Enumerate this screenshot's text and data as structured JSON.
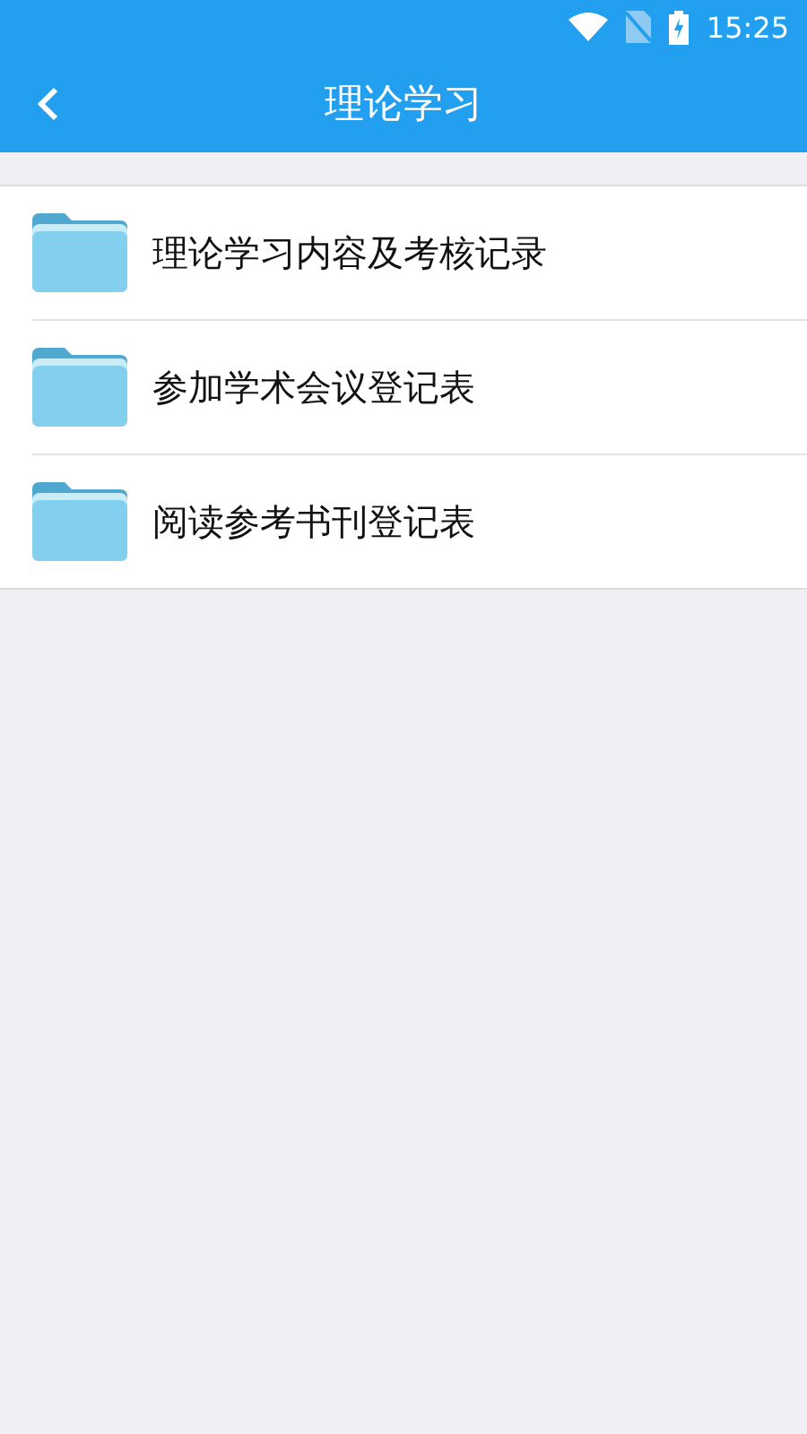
{
  "status_bar": {
    "time": "15:25"
  },
  "header": {
    "title": "理论学习"
  },
  "items": [
    {
      "label": "理论学习内容及考核记录"
    },
    {
      "label": "参加学术会议登记表"
    },
    {
      "label": "阅读参考书刊登记表"
    }
  ]
}
